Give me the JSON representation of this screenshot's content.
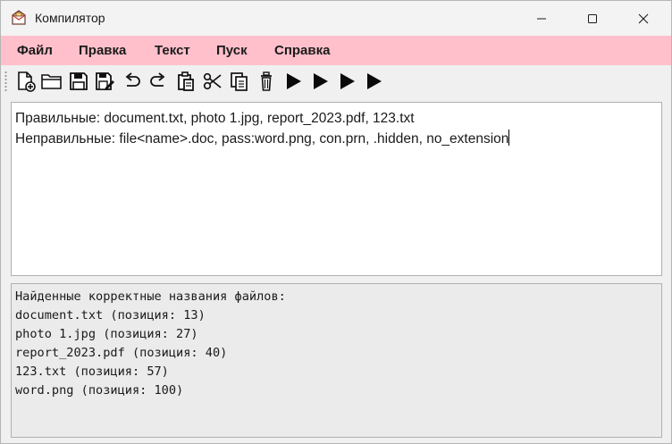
{
  "window": {
    "title": "Компилятор"
  },
  "menu": {
    "items": [
      "Файл",
      "Правка",
      "Текст",
      "Пуск",
      "Справка"
    ]
  },
  "toolbar": {
    "buttons": [
      "new-file-icon",
      "open-folder-icon",
      "save-icon",
      "save-as-icon",
      "undo-icon",
      "redo-icon",
      "paste-icon",
      "cut-icon",
      "copy-icon",
      "delete-icon",
      "run-icon",
      "run-icon",
      "run-icon",
      "run-icon"
    ]
  },
  "editor": {
    "lines": [
      "Правильные: document.txt, photo 1.jpg, report_2023.pdf, 123.txt",
      "Неправильные: file<name>.doc, pass:word.png, con.prn, .hidden, no_extension"
    ]
  },
  "output": {
    "lines": [
      "Найденные корректные названия файлов:",
      "document.txt (позиция: 13)",
      "photo 1.jpg (позиция: 27)",
      "report_2023.pdf (позиция: 40)",
      "123.txt (позиция: 57)",
      "word.png (позиция: 100)"
    ]
  },
  "colors": {
    "menubar": "#ffc0cb",
    "window": "#f0f0f0",
    "editor": "#ffffff",
    "output": "#ebebeb"
  }
}
